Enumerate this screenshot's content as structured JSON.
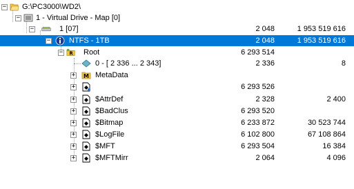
{
  "tree": {
    "nodes": [
      {
        "label": "G:\\PC3000\\WD2\\",
        "col1": "",
        "col2": ""
      },
      {
        "label": "1 - Virtual Drive - Map [0]",
        "col1": "",
        "col2": ""
      },
      {
        "label": "1 [07]",
        "col1": "2 048",
        "col2": "1 953 519 616"
      },
      {
        "label": "NTFS - 1TB",
        "col1": "2 048",
        "col2": "1 953 519 616"
      },
      {
        "label": "Root",
        "col1": "6 293 514",
        "col2": ""
      },
      {
        "label": "0 - [ 2 336 ... 2 343]",
        "col1": "2 336",
        "col2": "8"
      },
      {
        "label": "MetaData",
        "col1": "",
        "col2": ""
      },
      {
        "label": "",
        "col1": "6 293 526",
        "col2": ""
      },
      {
        "label": "$AttrDef",
        "col1": "2 328",
        "col2": "2 400"
      },
      {
        "label": "$BadClus",
        "col1": "6 293 520",
        "col2": ""
      },
      {
        "label": "$Bitmap",
        "col1": "6 233 872",
        "col2": "30 523 744"
      },
      {
        "label": "$LogFile",
        "col1": "6 102 800",
        "col2": "67 108 864"
      },
      {
        "label": "$MFT",
        "col1": "6 293 504",
        "col2": "16 384"
      },
      {
        "label": "$MFTMirr",
        "col1": "2 064",
        "col2": "4 096"
      }
    ],
    "expand_glyphs": {
      "collapse": "−",
      "expand": "+"
    },
    "icons": {
      "folder": "folder-icon",
      "drive": "virtual-drive-icon",
      "partition": "partition-icon",
      "filesystem": "info-icon",
      "root": "root-folder-icon",
      "fragment": "fragment-icon",
      "metadata": "metadata-icon",
      "file": "file-icon"
    },
    "colors": {
      "selection": "#0078d7"
    }
  }
}
